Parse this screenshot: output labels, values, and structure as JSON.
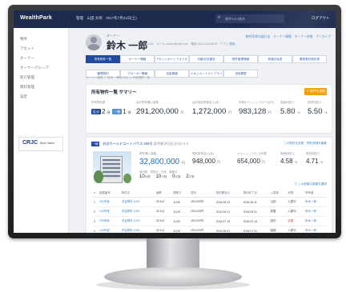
{
  "app": {
    "logo": "WealthPark",
    "user_info": "管理　山田 太郎　2017年7月21日(土)",
    "search_placeholder": "物件ID/口座名",
    "logout": "ログアウト"
  },
  "sidebar": {
    "items": [
      "物件",
      "アセット",
      "オーナー",
      "オーナーグループ",
      "取引管理",
      "資料管理",
      "設定"
    ],
    "bank_mark": "CRJC",
    "bank_sub": "Bank Name"
  },
  "owner": {
    "role": "オーナー",
    "name": "鈴木 一郎",
    "meta": "ID 1234　メール  owner@mail.com　電話 090-1234-5678　アプリ",
    "meta_link": "招待",
    "top_links": "物件売却の届け出　オーナー情報　オーナー台帳　アーカイブ"
  },
  "tabs": [
    "所有物件一覧",
    "オーナー情報",
    "アセットポートフォリオ",
    "月報/収支報告",
    "物件管理情報",
    "修繕計画書",
    "業務委託契約書",
    "管理契約",
    "ブローカー情報",
    "送金情報",
    "ドキュメントライブラリ",
    "送信履歴"
  ],
  "breadcrumb": "オーナー検索 ＞ 鈴木 一郎(1234) ＞ 所有物件一覧",
  "summary": {
    "title": "所有物件一覧 サマリー",
    "add_button": "＋ 物件を追加",
    "count_label": "所有物件数",
    "kinds": [
      {
        "tag": "区分",
        "count": "2",
        "unit": "棟"
      },
      {
        "tag": "一棟",
        "count": "1",
        "unit": "棟"
      }
    ],
    "stats": [
      {
        "label": "合計物件購入価格",
        "value": "291,200,000",
        "unit": "円"
      },
      {
        "label": "合計想定家賃収入(月)",
        "value": "1,272,000",
        "unit": "円"
      },
      {
        "label": "年間キャッシュフロー(合計)",
        "value": "983,128",
        "unit": "円"
      },
      {
        "label": "表面利回り",
        "value": "5.80",
        "unit": "%"
      },
      {
        "label": "実質利回り",
        "value": "5.50",
        "unit": "%"
      }
    ]
  },
  "property": {
    "badge": "一棟",
    "title": "渋谷ワールドコートハウス 205号",
    "title_sub": "東京都渋谷区渋谷1-2-3",
    "links": "この物件を変更　物件詳細を編集",
    "stats": [
      {
        "label": "物件購入価格",
        "value": "32,800,000",
        "unit": "円"
      },
      {
        "label": "想定家賃収入(月)",
        "value": "948,000",
        "unit": "円"
      },
      {
        "label": "キャッシュフロー(年間)",
        "value": "654,000",
        "unit": "円"
      },
      {
        "label": "表面利回り",
        "value": "4.58",
        "unit": "%"
      },
      {
        "label": "実質利回り",
        "value": "4.71",
        "unit": "%"
      }
    ],
    "units_label": "総戸数　賃貸中　空室　募集中",
    "units": [
      {
        "value": "10",
        "unit": "戸数"
      },
      {
        "value": "10",
        "unit": "戸数"
      },
      {
        "value": "0",
        "unit": "戸数"
      },
      {
        "value": "2",
        "unit": "戸数"
      }
    ],
    "select_link": "◎ この部屋の部屋を選択",
    "columns": [
      "#",
      "部屋番号",
      "物件名",
      "面積",
      "間取り",
      "賃料",
      "契約開始日",
      "契約終了日",
      "入居者",
      "状態",
      "所有者"
    ],
    "rows": [
      [
        "1",
        "101号室",
        "渋谷物件 1001",
        "32.5㎡",
        "1LDK",
        "150,000円",
        "2016.05.12",
        "2018.05.11",
        "山田",
        "入居中",
        "鈴木一郎"
      ],
      [
        "2",
        "102号室",
        "渋谷物件 1002",
        "32.5㎡",
        "1LDK",
        "150,000円",
        "2016.06.01",
        "2018.05.31",
        "佐藤",
        "入居中",
        "鈴木一郎"
      ],
      [
        "3",
        "103号室",
        "渋谷物件 1003",
        "32.5㎡",
        "1LDK",
        "150,000円",
        "2016.07.15",
        "2018.07.14",
        "田中",
        "空室",
        "鈴木一郎"
      ],
      [
        "4",
        "104号室",
        "渋谷物件 1004",
        "32.5㎡",
        "1LDK",
        "150,000円",
        "2016.08.01",
        "2018.07.31",
        "高橋",
        "入居中",
        "鈴木一郎"
      ]
    ]
  }
}
